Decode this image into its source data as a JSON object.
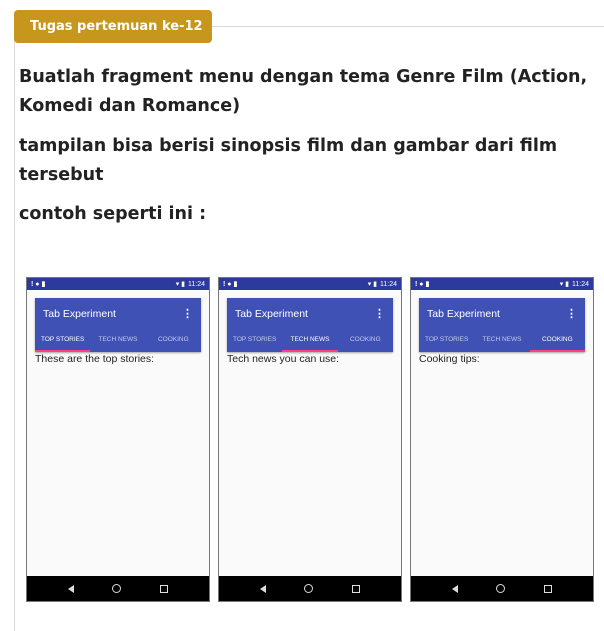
{
  "badge": {
    "label": "Tugas pertemuan ke-12"
  },
  "paragraphs": [
    "Buatlah fragment menu dengan tema Genre Film (Action, Komedi dan Romance)",
    "tampilan bisa berisi sinopsis film dan gambar dari film tersebut",
    "contoh seperti ini :"
  ],
  "phones": [
    {
      "status": {
        "left_icons": "! ● ▮",
        "time": "11:24"
      },
      "app_title": "Tab Experiment",
      "tabs": [
        "TOP STORIES",
        "TECH NEWS",
        "COOKING"
      ],
      "active_tab": 0,
      "content": "These are the top stories:"
    },
    {
      "status": {
        "left_icons": "! ● ▮",
        "time": "11:24"
      },
      "app_title": "Tab Experiment",
      "tabs": [
        "TOP STORIES",
        "TECH NEWS",
        "COOKING"
      ],
      "active_tab": 1,
      "content": "Tech news you can use:"
    },
    {
      "status": {
        "left_icons": "! ● ▮",
        "time": "11:24"
      },
      "app_title": "Tab Experiment",
      "tabs": [
        "TOP STORIES",
        "TECH NEWS",
        "COOKING"
      ],
      "active_tab": 2,
      "content": "Cooking tips:"
    }
  ],
  "colors": {
    "badge": "#c6971c",
    "statusbar": "#2b3a9c",
    "appbar": "#3f51b5",
    "indicator": "#ff4081",
    "navbar": "#000000"
  },
  "icons": {
    "overflow": "more-vert-icon",
    "back": "back-icon",
    "home": "home-icon",
    "recent": "recent-apps-icon"
  }
}
